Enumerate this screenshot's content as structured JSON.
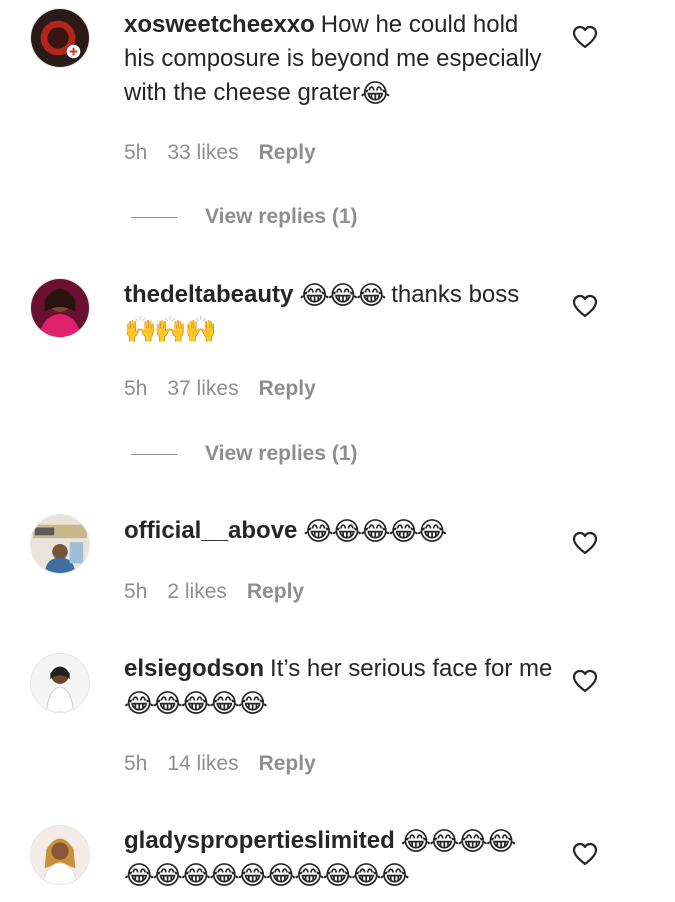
{
  "comments": [
    {
      "username": "xosweetcheexxo",
      "text": "How he could hold his composure is beyond me especially with the cheese grater",
      "emoji": "😂",
      "time": "5h",
      "likes": "33 likes",
      "reply": "Reply",
      "view_replies": "View replies (1)"
    },
    {
      "username": "thedeltabeauty",
      "emoji_a": "😂😂😂",
      "text": "thanks boss",
      "emoji_b": "🙌🙌🙌",
      "time": "5h",
      "likes": "37 likes",
      "reply": "Reply",
      "view_replies": "View replies (1)"
    },
    {
      "username": "official__above",
      "emoji": "😂😂😂😂😂",
      "time": "5h",
      "likes": "2 likes",
      "reply": "Reply"
    },
    {
      "username": "elsiegodson",
      "text": "It’s her serious face for me",
      "emoji": "😂😂😂😂😂",
      "time": "5h",
      "likes": "14 likes",
      "reply": "Reply"
    },
    {
      "username": "gladyspropertieslimited",
      "emoji_a": "😂😂😂😂",
      "emoji_b": "😂😂😂😂😂😂😂😂😂😂"
    }
  ],
  "icons": {
    "like": "heart-outline-icon"
  },
  "colors": {
    "text": "#262626",
    "secondary": "#8e8e8e",
    "background": "#ffffff"
  }
}
